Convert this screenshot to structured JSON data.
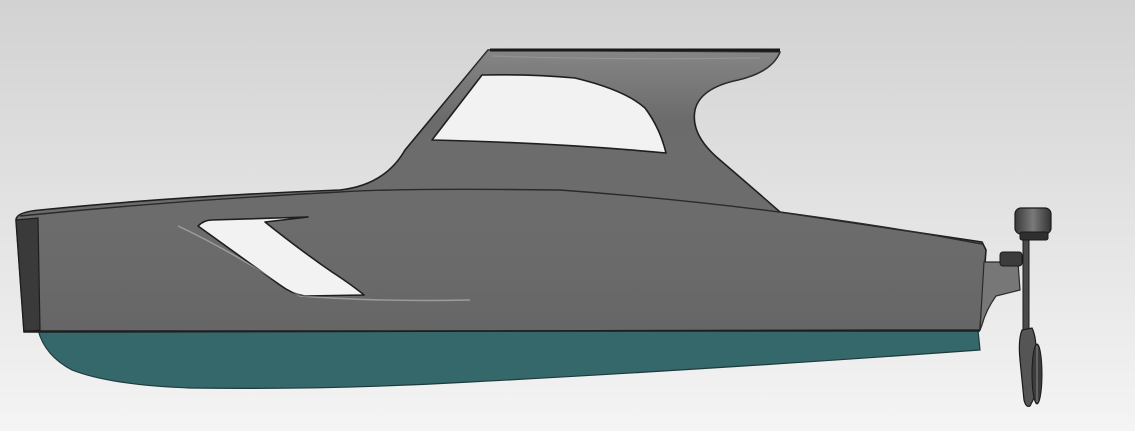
{
  "viewer": {
    "background_top": "#d2d2d2",
    "background_bottom": "#f4f4f4"
  },
  "colors": {
    "hull_topsides": "#6b6b6b",
    "hull_edge": "#1e1e1e",
    "bow_face": "#3a3a3a",
    "antifouling": "#35686a",
    "window_fill": "#f2f2f2",
    "outboard": "#555555",
    "outboard_dark": "#2a2a2a"
  },
  "model": {
    "name": "",
    "parts": [
      "hull",
      "cabin-top",
      "windshield",
      "hull-window",
      "antifouling-bottom",
      "transom-bracket",
      "outboard-motor"
    ]
  }
}
